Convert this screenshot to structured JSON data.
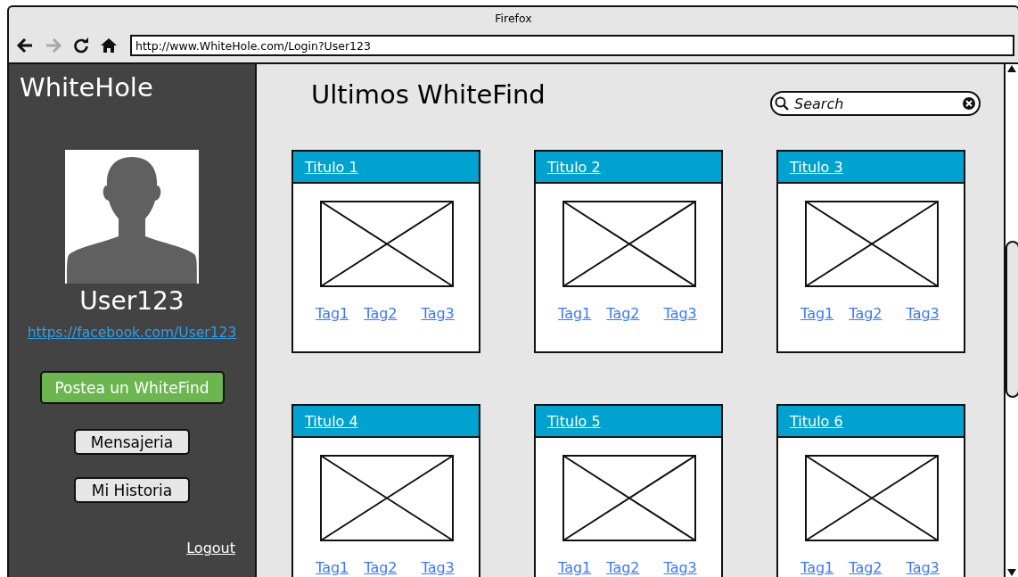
{
  "window": {
    "title": "Firefox"
  },
  "toolbar": {
    "nav_buttons": [
      {
        "kind": "back",
        "disabled": false
      },
      {
        "kind": "forward",
        "disabled": true
      },
      {
        "kind": "reload",
        "disabled": false
      },
      {
        "kind": "home",
        "disabled": false
      }
    ],
    "address_bar": {
      "value": "http://www.WhiteHole.com/Login?User123"
    }
  },
  "sidebar": {
    "logo": "WhiteHole",
    "username": "User123",
    "profile_link": "https://facebook.com/User123",
    "buttons": [
      {
        "label": "Postea un WhiteFind",
        "kind": "primary"
      },
      {
        "label": "Mensajeria",
        "kind": "secondary"
      },
      {
        "label": "Mi Historia",
        "kind": "secondary"
      }
    ],
    "logout": "Logout"
  },
  "main": {
    "heading": "Ultimos WhiteFind",
    "search": {
      "placeholder": "Search"
    },
    "cards": [
      {
        "title": "Titulo 1",
        "tags": [
          "Tag1",
          "Tag2",
          "Tag3"
        ]
      },
      {
        "title": "Titulo 2",
        "tags": [
          "Tag1",
          "Tag2",
          "Tag3"
        ]
      },
      {
        "title": "Titulo 3",
        "tags": [
          "Tag1",
          "Tag2",
          "Tag3"
        ]
      },
      {
        "title": "Titulo 4",
        "tags": [
          "Tag1",
          "Tag2",
          "Tag3"
        ]
      },
      {
        "title": "Titulo 5",
        "tags": [
          "Tag1",
          "Tag2",
          "Tag3"
        ]
      },
      {
        "title": "Titulo 6",
        "tags": [
          "Tag1",
          "Tag2",
          "Tag3"
        ]
      }
    ]
  }
}
